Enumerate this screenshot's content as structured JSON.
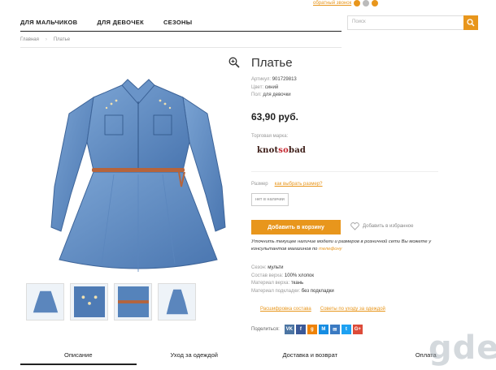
{
  "top": {
    "callback": "обратный звонок"
  },
  "nav": {
    "items": [
      "ДЛЯ МАЛЬЧИКОВ",
      "ДЛЯ ДЕВОЧЕК",
      "СЕЗОНЫ"
    ]
  },
  "search": {
    "placeholder": "Поиск"
  },
  "breadcrumb": {
    "home": "Главная",
    "sep": "›",
    "current": "Платье"
  },
  "product": {
    "title": "Платье",
    "article_k": "Артикул:",
    "article_v": "901729813",
    "color_k": "Цвет:",
    "color_v": "синий",
    "gender_k": "Пол:",
    "gender_v": "для девочки",
    "price": "63,90 руб.",
    "brand_label": "Торговая марка:",
    "brand_logo": "knot so bad",
    "size_k": "Размер",
    "size_link": "как выбрать размер?",
    "not_available": "нет в наличии",
    "add_to_cart": "Добавить в корзину",
    "add_fav": "Добавить в избранное",
    "note": "Уточнить текущее наличие модели и размеров в розничной сети Вы можете у консультантов магазинов по",
    "note_link": "телефону",
    "season_k": "Сезон:",
    "season_v": "мульти",
    "comp_k": "Состав верха:",
    "comp_v": "100% хлопок",
    "mat_k": "Материал верха:",
    "mat_v": "ткань",
    "lining_k": "Материал подкладки:",
    "lining_v": "без подкладки",
    "link_care_code": "Расшифровка состава",
    "link_care_tips": "Советы по уходу за одеждой",
    "share_label": "Поделиться:"
  },
  "share_icons": [
    "VK",
    "f",
    "g",
    "M",
    "✉",
    "t",
    "G+"
  ],
  "tabs": [
    "Описание",
    "Уход за одеждой",
    "Доставка и возврат",
    "Оплата"
  ],
  "watermark": "gde",
  "colors": {
    "accent": "#e8961c",
    "denim": "#5b86bd",
    "denim_dark": "#3d6499"
  }
}
